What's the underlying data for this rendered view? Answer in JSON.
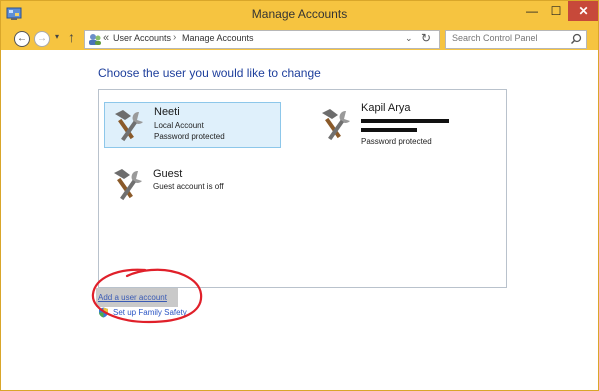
{
  "window": {
    "title": "Manage Accounts",
    "minimize_icon": "minimize-icon",
    "maximize_icon": "maximize-icon",
    "close_icon": "close-icon",
    "min_glyph": "—",
    "max_glyph": "☐",
    "close_glyph": "✕"
  },
  "navigation": {
    "back_glyph": "←",
    "forward_glyph": "→",
    "recent_glyph": "▾",
    "up_glyph": "↑",
    "breadcrumb_prefix": "«",
    "breadcrumb": [
      "User Accounts",
      "Manage Accounts"
    ],
    "breadcrumb_separator": "›",
    "dropdown_glyph": "⌄",
    "refresh_glyph": "↻",
    "search_placeholder": "Search Control Panel"
  },
  "main": {
    "heading": "Choose the user you would like to change",
    "accounts": [
      {
        "name": "Neeti",
        "line1": "Local Account",
        "line2": "Password protected",
        "selected": true
      },
      {
        "name": "Kapil Arya",
        "line1": "",
        "line2": "Password protected",
        "redacted": true,
        "selected": false
      },
      {
        "name": "Guest",
        "line1": "Guest account is off",
        "line2": "",
        "selected": false
      }
    ],
    "links": {
      "add_user": "Add a user account",
      "family_safety": "Set up Family Safety"
    }
  },
  "colors": {
    "title_bar": "#f6c440",
    "close_button": "#c7493a",
    "heading": "#1e3f9c",
    "link": "#2a55c4",
    "annotation": "#e0202a",
    "selected_tile": "#dff0fb"
  }
}
